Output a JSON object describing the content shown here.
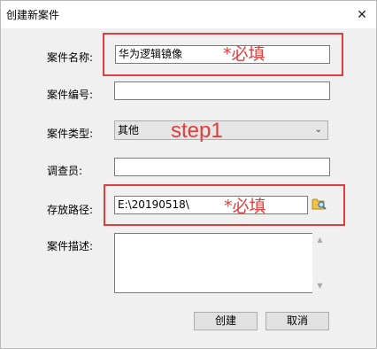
{
  "window": {
    "title": "创建新案件"
  },
  "form": {
    "case_name_label": "案件名称:",
    "case_name_value": "华为逻辑镜像",
    "case_number_label": "案件编号:",
    "case_number_value": "",
    "case_type_label": "案件类型:",
    "case_type_value": "其他",
    "investigator_label": "调查员:",
    "investigator_value": "",
    "save_path_label": "存放路径:",
    "save_path_value": "E:\\20190518\\",
    "description_label": "案件描述:",
    "description_value": ""
  },
  "buttons": {
    "create": "创建",
    "cancel": "取消"
  },
  "annotations": {
    "required_1": "*必填",
    "step": "step1",
    "required_2": "*必填"
  },
  "colors": {
    "annotation": "#e23c3c"
  }
}
